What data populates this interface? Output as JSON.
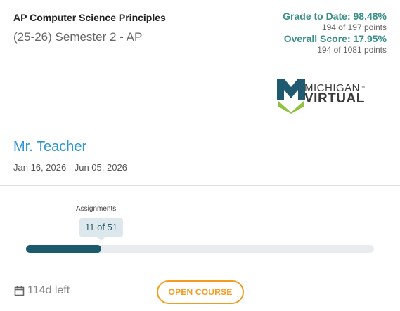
{
  "course": {
    "title": "AP Computer Science Principles",
    "term": "(25-26) Semester 2 - AP"
  },
  "grades": {
    "grade_to_date": "Grade to Date: 98.48%",
    "grade_points": "194 of 197 points",
    "overall_score": "Overall Score: 17.95%",
    "overall_points": "194 of 1081 points",
    "accent_color": "#3a8f86"
  },
  "logo": {
    "line1": "MICHIGAN",
    "tm": "™",
    "line2": "VIRTUAL",
    "icon": "michigan-virtual-logo"
  },
  "teacher": {
    "name": "Mr. Teacher",
    "dates": "Jan 16, 2026 - Jun 05, 2026",
    "name_color": "#2b95d6"
  },
  "progress": {
    "label": "Assignments",
    "tooltip": "11 of 51",
    "completed": 11,
    "total": 51,
    "fill_color": "#1a5a6b"
  },
  "footer": {
    "days_left": "114d left",
    "days_icon": "calendar-icon",
    "open_button": "OPEN COURSE",
    "button_color": "#f39c1f"
  }
}
